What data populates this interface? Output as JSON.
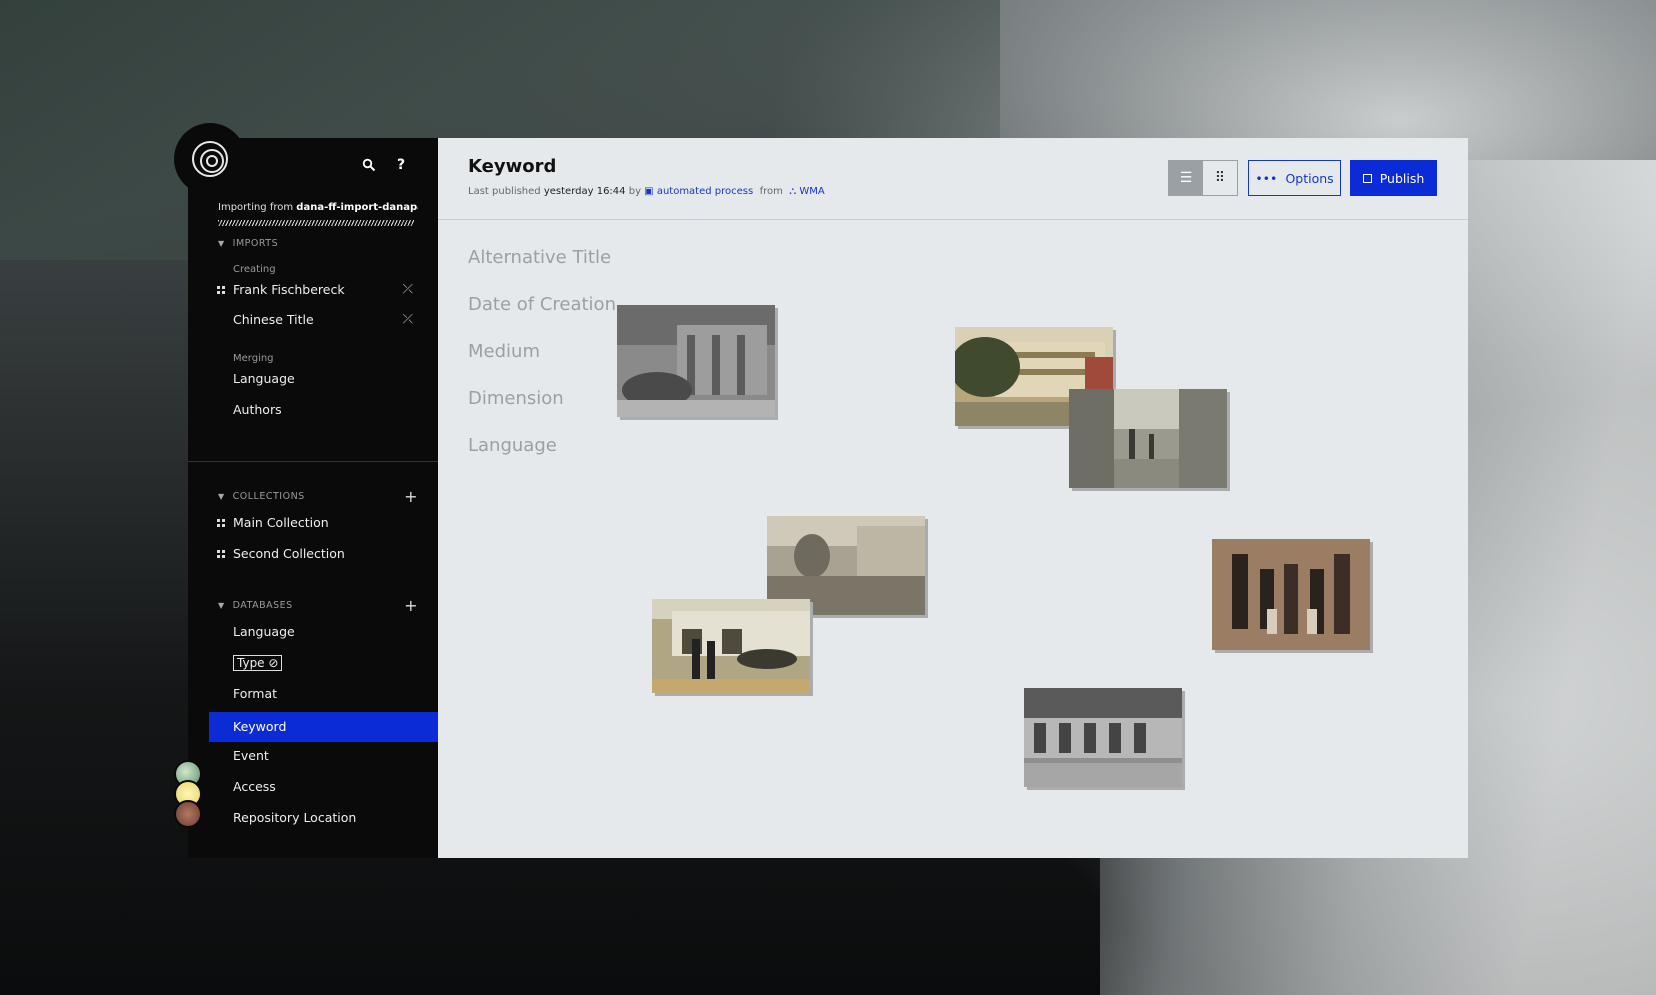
{
  "sidebar": {
    "import_prefix": "Importing from",
    "import_source": "dana-ff-import-danapa...",
    "imports": {
      "heading": "IMPORTS",
      "creating_label": "Creating",
      "creating_items": [
        "Frank Fischbereck",
        "Chinese Title"
      ],
      "merging_label": "Merging",
      "merging_items": [
        "Language",
        "Authors"
      ]
    },
    "collections": {
      "heading": "COLLECTIONS",
      "items": [
        "Main Collection",
        "Second Collection"
      ]
    },
    "databases": {
      "heading": "DATABASES",
      "items": [
        "Language",
        "Type",
        "Format",
        "Keyword",
        "Event",
        "Access",
        "Repository Location"
      ],
      "active": "Keyword"
    }
  },
  "header": {
    "title": "Keyword",
    "meta_prefix": "Last published",
    "meta_time": "yesterday 16:44",
    "meta_by": "by",
    "meta_actor": "automated process",
    "meta_from": "from",
    "meta_source": "WMA",
    "options_label": "Options",
    "publish_label": "Publish"
  },
  "fields": [
    "Alternative Title",
    "Date of Creation",
    "Medium",
    "Dimension",
    "Language"
  ],
  "colors": {
    "accent": "#0b2bd6",
    "link": "#1636c9",
    "sidebar_bg": "#0a0a0a",
    "main_bg": "#e6e9eb"
  },
  "icons": {
    "search": "search-icon",
    "help": "help-icon",
    "list_view": "list-view-icon",
    "grid_view": "grid-view-icon"
  }
}
